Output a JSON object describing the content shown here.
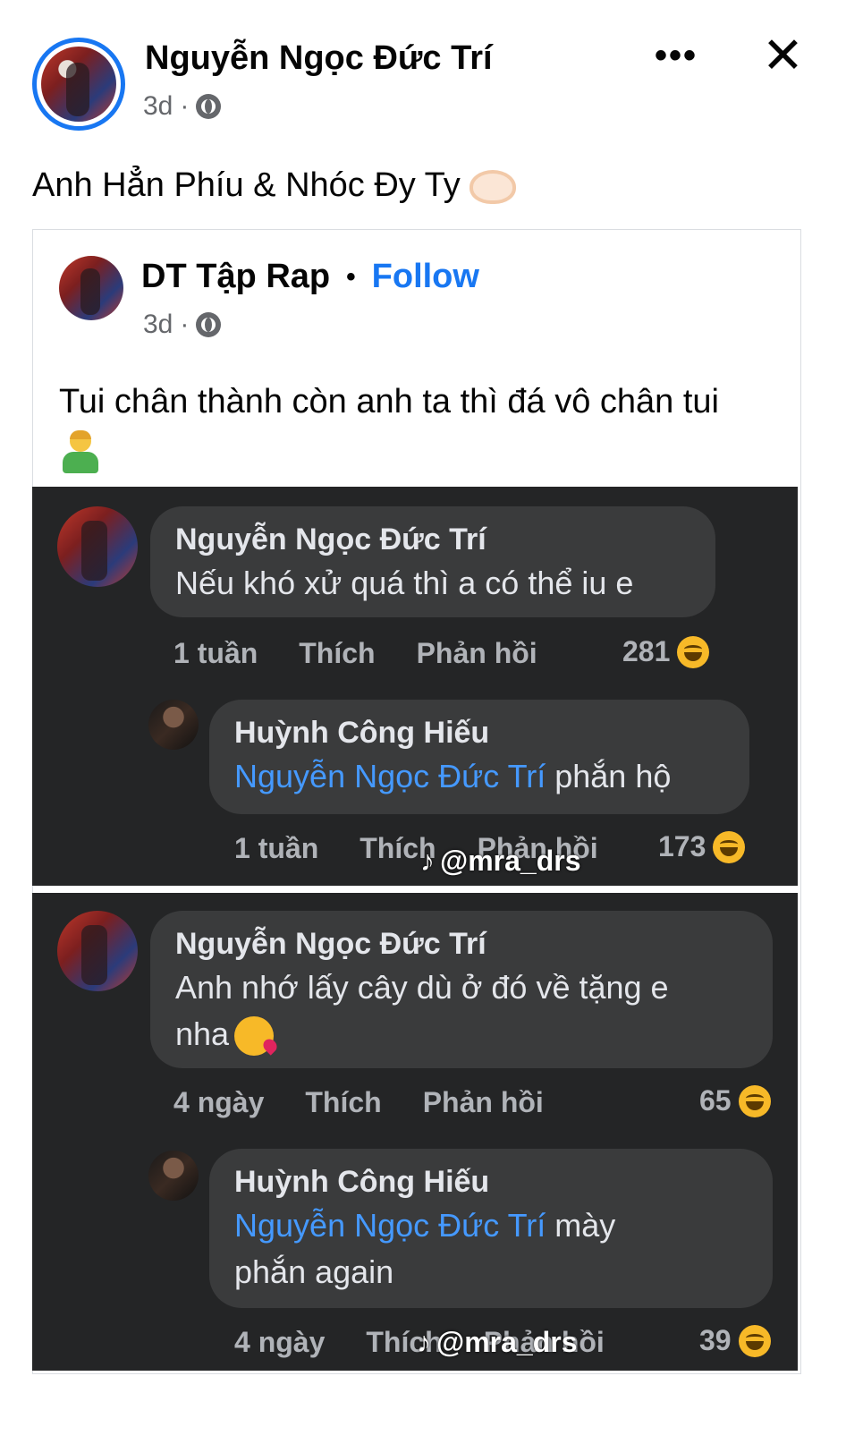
{
  "post": {
    "author": "Nguyễn Ngọc Đức Trí",
    "time": "3d",
    "text": "Anh Hẳn Phíu & Nhóc Đy Ty"
  },
  "shared": {
    "page_name": "DT Tập Rap",
    "separator": "•",
    "follow_label": "Follow",
    "time": "3d",
    "text": "Tui chân thành còn anh ta thì đá vô chân tui"
  },
  "screenshot1": {
    "comment": {
      "author": "Nguyễn Ngọc Đức Trí",
      "text": "Nếu khó xử quá thì a có thể iu e",
      "time": "1 tuần",
      "like": "Thích",
      "reply": "Phản hồi",
      "reactions": "281"
    },
    "reply": {
      "author": "Huỳnh Công Hiếu",
      "mention": "Nguyễn Ngọc Đức Trí",
      "text": " phắn hộ",
      "time": "1 tuần",
      "like": "Thích",
      "reply": "Phản hồi",
      "reactions": "173"
    },
    "watermark": "@mra_drs"
  },
  "screenshot2": {
    "comment": {
      "author": "Nguyễn Ngọc Đức Trí",
      "text_line1": "Anh nhớ lấy cây dù ở đó về tặng e",
      "text_line2": "nha",
      "time": "4 ngày",
      "like": "Thích",
      "reply": "Phản hồi",
      "reactions": "65"
    },
    "reply": {
      "author": "Huỳnh Công Hiếu",
      "mention": "Nguyễn Ngọc Đức Trí",
      "text_line1": " mày",
      "text_line2": "phắn again",
      "time": "4 ngày",
      "like": "Thích",
      "reply": "Phản hồi",
      "reactions": "39"
    },
    "watermark": "@mra_drs"
  },
  "icons": {
    "more": "more-horizontal-icon",
    "close": "close-icon",
    "privacy": "globe-icon",
    "reaction": "haha-reaction-icon",
    "watermark": "tiktok-icon"
  },
  "colors": {
    "link": "#1877f2",
    "dark_bg": "#242526",
    "bubble_bg": "#3a3b3c",
    "mention": "#4599ff"
  }
}
